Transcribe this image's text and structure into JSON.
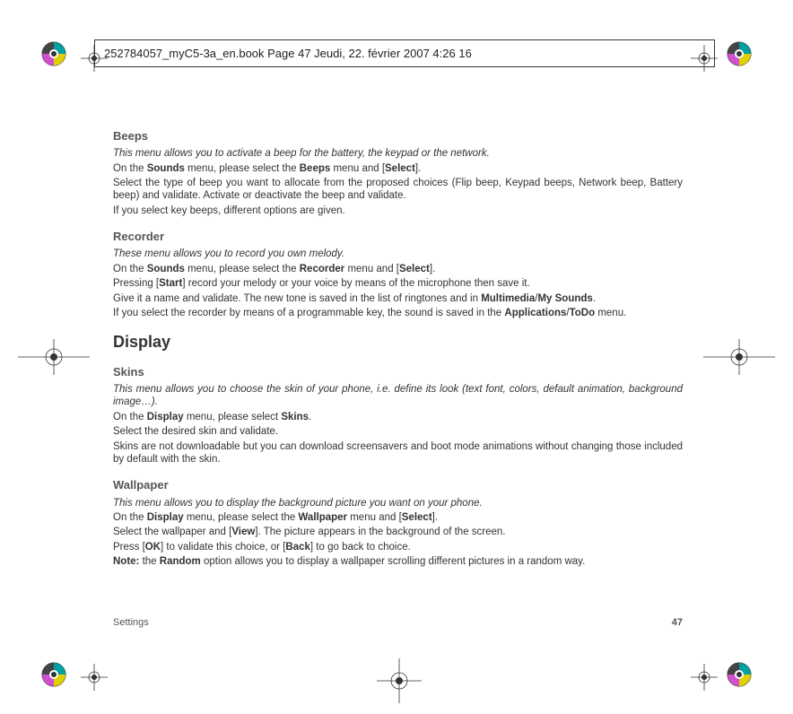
{
  "header": {
    "text": "252784057_myC5-3a_en.book  Page 47  Jeudi, 22. février 2007  4:26 16"
  },
  "sections": {
    "beeps": {
      "title": "Beeps",
      "intro": "This menu allows you to activate a beep for the battery, the keypad or the network.",
      "p1a": "On the ",
      "p1b": "Sounds",
      "p1c": " menu, please select the ",
      "p1d": "Beeps",
      "p1e": " menu and [",
      "p1f": "Select",
      "p1g": "].",
      "p2": "Select the type of beep you want to allocate from the proposed choices (Flip beep, Keypad beeps, Network beep, Battery beep) and validate. Activate or deactivate the beep and validate.",
      "p3": "If you select key beeps, different options are given."
    },
    "recorder": {
      "title": "Recorder",
      "intro": "These menu allows you to record you own melody.",
      "p1a": "On the ",
      "p1b": "Sounds",
      "p1c": " menu, please select the ",
      "p1d": "Recorder",
      "p1e": " menu and [",
      "p1f": "Select",
      "p1g": "].",
      "p2a": "Pressing [",
      "p2b": "Start",
      "p2c": "] record your melody or your voice by means of the microphone then save it.",
      "p3a": "Give it a name and validate. The new tone is saved in the list of ringtones and in ",
      "p3b": "Multimedia",
      "p3c": "/",
      "p3d": "My Sounds",
      "p3e": ".",
      "p4a": "If you select the recorder by means of a programmable key, the sound is saved in the ",
      "p4b": "Applications",
      "p4c": "/",
      "p4d": "ToDo",
      "p4e": " menu."
    },
    "display": {
      "title": "Display"
    },
    "skins": {
      "title": "Skins",
      "intro": "This menu allows you to choose the skin of your phone, i.e. define its look (text font, colors, default animation, background image…).",
      "p1a": "On the ",
      "p1b": "Display",
      "p1c": " menu, please select ",
      "p1d": "Skins",
      "p1e": ".",
      "p2": "Select the desired skin and validate.",
      "p3": "Skins are not downloadable but you can download screensavers and boot mode animations without changing those included by default with the skin."
    },
    "wallpaper": {
      "title": "Wallpaper",
      "intro": "This menu allows you to display the background picture you want on your phone.",
      "p1a": "On the ",
      "p1b": "Display",
      "p1c": " menu, please select the ",
      "p1d": "Wallpaper",
      "p1e": " menu and [",
      "p1f": "Select",
      "p1g": "].",
      "p2a": "Select the wallpaper and [",
      "p2b": "View",
      "p2c": "]. The picture appears in the background of the screen.",
      "p3a": "Press [",
      "p3b": "OK",
      "p3c": "] to validate this choice, or [",
      "p3d": "Back",
      "p3e": "] to go back to choice.",
      "p4a": "Note:",
      "p4b": " the ",
      "p4c": "Random",
      "p4d": " option allows you to display a wallpaper scrolling different pictures in a random way."
    }
  },
  "footer": {
    "label": "Settings",
    "page": "47"
  }
}
